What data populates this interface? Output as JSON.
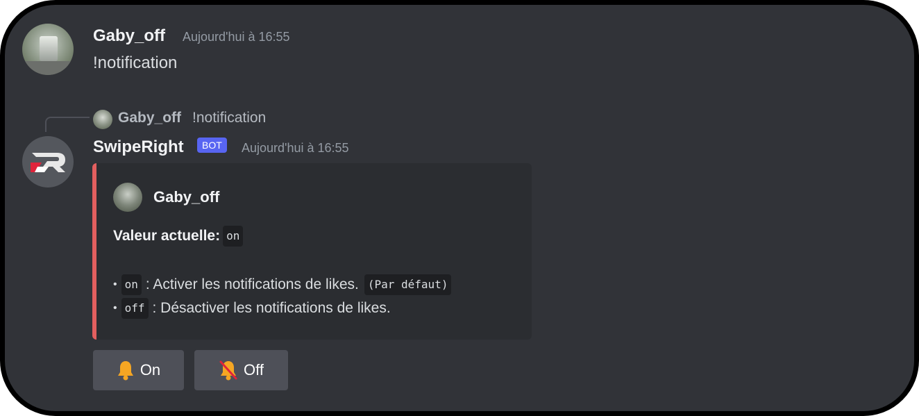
{
  "messages": [
    {
      "author": "Gaby_off",
      "timestamp": "Aujourd'hui à 16:55",
      "content": "!notification"
    }
  ],
  "reply": {
    "author": "Gaby_off",
    "content": "!notification"
  },
  "bot_message": {
    "author": "SwipeRight",
    "badge": "BOT",
    "timestamp": "Aujourd'hui à 16:55",
    "embed": {
      "accent_color": "#e35f5f",
      "author_name": "Gaby_off",
      "field_label": "Valeur actuelle:",
      "current_value": "on",
      "options": [
        {
          "bullet": "•",
          "code": "on",
          "description": ": Activer les notifications de likes.",
          "default_tag": "(Par défaut)"
        },
        {
          "bullet": "•",
          "code": "off",
          "description": ": Désactiver les notifications de likes."
        }
      ]
    },
    "buttons": [
      {
        "label": "On",
        "icon": "bell-icon"
      },
      {
        "label": "Off",
        "icon": "bell-slash-icon"
      }
    ]
  },
  "colors": {
    "background": "#313338",
    "embed_background": "#2b2d31",
    "bot_badge": "#5865f2",
    "button_background": "#4e5058",
    "bell": "#f5a623",
    "brand_red": "#e0243b"
  }
}
